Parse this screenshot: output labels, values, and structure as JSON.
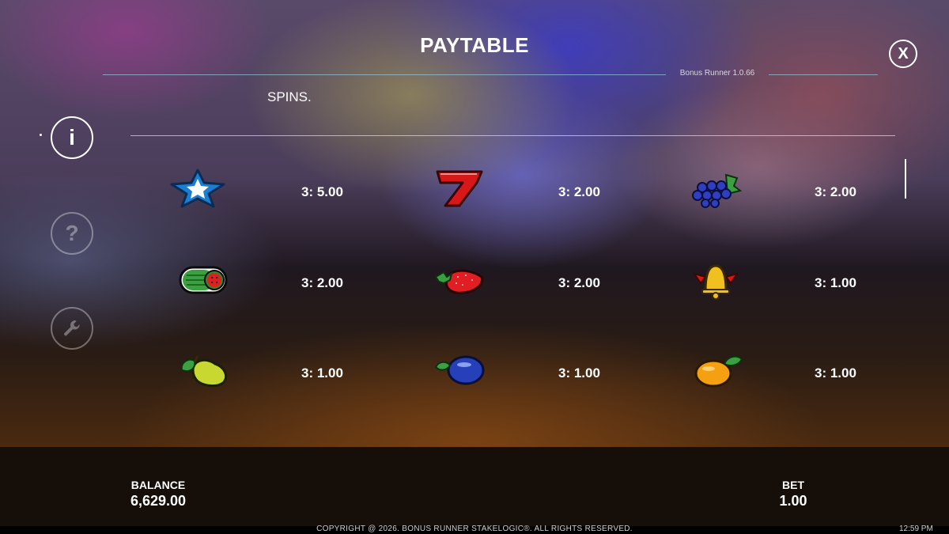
{
  "header": {
    "title": "PAYTABLE",
    "version": "Bonus Runner 1.0.66",
    "close_label": "X"
  },
  "content": {
    "intro_text": "SPINS."
  },
  "nav": {
    "info_glyph": "i",
    "help_glyph": "?",
    "settings_icon": "wrench-icon"
  },
  "paytable": {
    "rows": [
      [
        {
          "symbol": "star",
          "payout": "3: 5.00"
        },
        {
          "symbol": "seven",
          "payout": "3: 2.00"
        },
        {
          "symbol": "grapes",
          "payout": "3: 2.00"
        }
      ],
      [
        {
          "symbol": "watermelon",
          "payout": "3: 2.00"
        },
        {
          "symbol": "strawberry",
          "payout": "3: 2.00"
        },
        {
          "symbol": "bell",
          "payout": "3: 1.00"
        }
      ],
      [
        {
          "symbol": "pear",
          "payout": "3: 1.00"
        },
        {
          "symbol": "plum",
          "payout": "3: 1.00"
        },
        {
          "symbol": "orange",
          "payout": "3: 1.00"
        }
      ]
    ]
  },
  "footer": {
    "balance_label": "BALANCE",
    "balance_value": "6,629.00",
    "bet_label": "BET",
    "bet_value": "1.00",
    "copyright": "COPYRIGHT @ 2026. BONUS RUNNER STAKELOGIC®. ALL RIGHTS RESERVED.",
    "clock": "12:59 PM"
  },
  "colors": {
    "accent_line": "#96c8dc",
    "footer_bg": "#160e08"
  }
}
